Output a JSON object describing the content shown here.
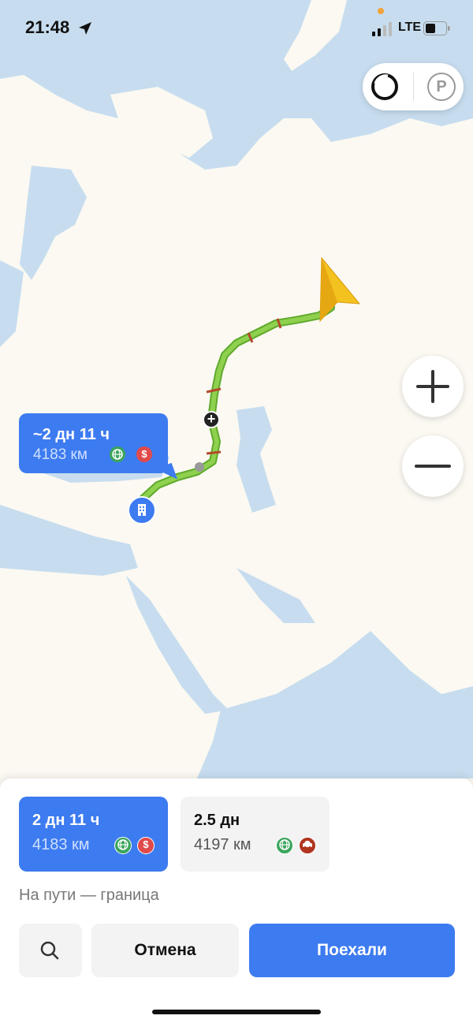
{
  "status_bar": {
    "time": "21:48",
    "network": "LTE"
  },
  "map": {
    "route_bubble": {
      "time": "~2 дн 11 ч",
      "distance": "4183 км"
    }
  },
  "route_options": [
    {
      "time": "2 дн 11 ч",
      "distance": "4183 км",
      "selected": true
    },
    {
      "time": "2.5 дн",
      "distance": "4197 км",
      "selected": false
    }
  ],
  "route_note": "На пути — граница",
  "actions": {
    "cancel_label": "Отмена",
    "go_label": "Поехали"
  },
  "colors": {
    "accent": "#3d7bf0",
    "route": "#8fd14f",
    "water": "#c7ddef",
    "land": "#fbf9f2"
  }
}
